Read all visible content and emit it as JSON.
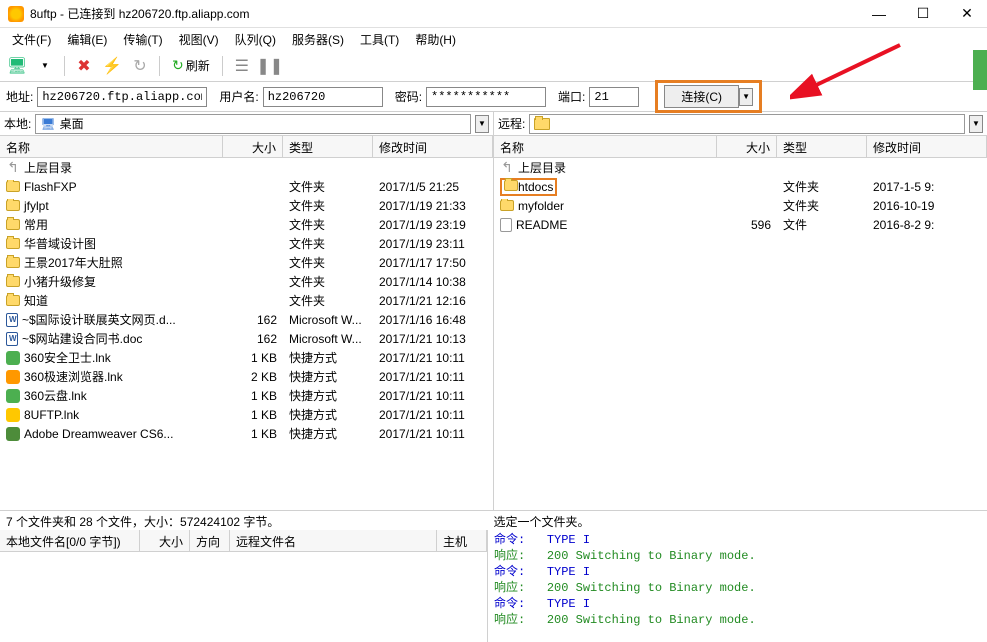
{
  "title": "8uftp - 已连接到 hz206720.ftp.aliapp.com",
  "menu": [
    "文件(F)",
    "编辑(E)",
    "传输(T)",
    "视图(V)",
    "队列(Q)",
    "服务器(S)",
    "工具(T)",
    "帮助(H)"
  ],
  "toolbar": {
    "refresh": "刷新"
  },
  "connect": {
    "addr_label": "地址:",
    "addr": "hz206720.ftp.aliapp.com",
    "user_label": "用户名:",
    "user": "hz206720",
    "pass_label": "密码:",
    "pass": "***********",
    "port_label": "端口:",
    "port": "21",
    "connect_btn": "连接(C)"
  },
  "local": {
    "label": "本地:",
    "path": "桌面",
    "headers": {
      "name": "名称",
      "size": "大小",
      "type": "类型",
      "date": "修改时间"
    },
    "rows": [
      {
        "icon": "up",
        "name": "上层目录"
      },
      {
        "icon": "folder",
        "name": "FlashFXP",
        "type": "文件夹",
        "date": "2017/1/5 21:25"
      },
      {
        "icon": "folder",
        "name": "jfylpt",
        "type": "文件夹",
        "date": "2017/1/19 21:33"
      },
      {
        "icon": "folder",
        "name": "常用",
        "type": "文件夹",
        "date": "2017/1/19 23:19"
      },
      {
        "icon": "folder",
        "name": "华普域设计图",
        "type": "文件夹",
        "date": "2017/1/19 23:11"
      },
      {
        "icon": "folder",
        "name": "王景2017年大肚照",
        "type": "文件夹",
        "date": "2017/1/17 17:50"
      },
      {
        "icon": "folder",
        "name": "小猪升级修复",
        "type": "文件夹",
        "date": "2017/1/14 10:38"
      },
      {
        "icon": "folder",
        "name": "知道",
        "type": "文件夹",
        "date": "2017/1/21 12:16"
      },
      {
        "icon": "word",
        "name": "~$国际设计联展英文网页.d...",
        "size": "162",
        "type": "Microsoft W...",
        "date": "2017/1/16 16:48"
      },
      {
        "icon": "word",
        "name": "~$网站建设合同书.doc",
        "size": "162",
        "type": "Microsoft W...",
        "date": "2017/1/21 10:13"
      },
      {
        "icon": "app-green",
        "name": "360安全卫士.lnk",
        "size": "1 KB",
        "type": "快捷方式",
        "date": "2017/1/21 10:11"
      },
      {
        "icon": "app-orange",
        "name": "360极速浏览器.lnk",
        "size": "2 KB",
        "type": "快捷方式",
        "date": "2017/1/21 10:11"
      },
      {
        "icon": "app-green",
        "name": "360云盘.lnk",
        "size": "1 KB",
        "type": "快捷方式",
        "date": "2017/1/21 10:11"
      },
      {
        "icon": "app-yellow",
        "name": "8UFTP.lnk",
        "size": "1 KB",
        "type": "快捷方式",
        "date": "2017/1/21 10:11"
      },
      {
        "icon": "app-teal",
        "name": "Adobe Dreamweaver CS6...",
        "size": "1 KB",
        "type": "快捷方式",
        "date": "2017/1/21 10:11"
      }
    ],
    "status": "7 个文件夹和 28 个文件，大小：572424102 字节。"
  },
  "remote": {
    "label": "远程:",
    "headers": {
      "name": "名称",
      "size": "大小",
      "type": "类型",
      "date": "修改时间"
    },
    "rows": [
      {
        "icon": "up",
        "name": "上层目录"
      },
      {
        "icon": "folder",
        "name": "htdocs",
        "type": "文件夹",
        "date": "2017-1-5 9:",
        "highlight": true
      },
      {
        "icon": "folder",
        "name": "myfolder",
        "type": "文件夹",
        "date": "2016-10-19"
      },
      {
        "icon": "txt",
        "name": "README",
        "size": "596",
        "type": "文件",
        "date": "2016-8-2 9:"
      }
    ],
    "status": "选定一个文件夹。"
  },
  "queue_headers": {
    "name": "本地文件名[0/0 字节])",
    "size": "大小",
    "dir": "方向",
    "remote": "远程文件名",
    "host": "主机"
  },
  "log": [
    {
      "t": "cmd",
      "label": "命令:",
      "text": "TYPE I"
    },
    {
      "t": "resp",
      "label": "响应:",
      "text": "200 Switching to Binary mode."
    },
    {
      "t": "cmd",
      "label": "命令:",
      "text": "TYPE I"
    },
    {
      "t": "resp",
      "label": "响应:",
      "text": "200 Switching to Binary mode."
    },
    {
      "t": "cmd",
      "label": "命令:",
      "text": "TYPE I"
    },
    {
      "t": "resp",
      "label": "响应:",
      "text": "200 Switching to Binary mode."
    }
  ]
}
